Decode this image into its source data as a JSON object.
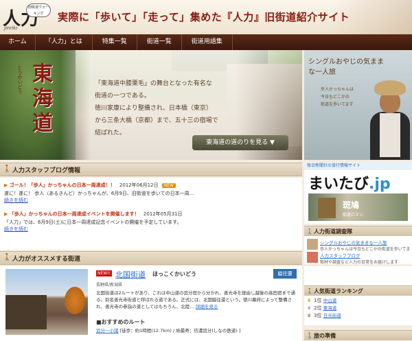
{
  "header": {
    "logo_text": "人力",
    "logo_sub": "jinriki",
    "logo_bubble": "旧街道ウォーキング",
    "title": "実際に「歩いて」「走って」集めた『人力』旧街道紹介サイト"
  },
  "nav": [
    "ホーム",
    "「人力」とは",
    "特集一覧",
    "街道一覧",
    "街道用語集"
  ],
  "hero": {
    "ruby": "とうかいどう",
    "title": "東海道",
    "text_lines": [
      "「東海道中膝栗毛」の舞台となった有名な",
      "街道の一つである。",
      "徳川家康により整備され、日本橋（東京）",
      "から三条大橋（京都）まで、五十三の宿場で",
      "結ばれた。"
    ],
    "button": "東海道の道のりを見る ▼"
  },
  "side_banner": {
    "title": "シングルおやじの気ままな一人旅",
    "sub_lines": [
      "歩人かっちゃんは",
      "今日もどこかの",
      "街道を歩いてます"
    ]
  },
  "blog": {
    "title": "人力スタッフブログ情報",
    "items": [
      {
        "link": "ゴール！「歩人」かっちゃんの日本一周達成！！",
        "date": "2012年06月12日",
        "badge": "NEW",
        "body": "遂に！遂に！ 歩人（あるきんど）かっちゃんが、6月9日、旧街道を歩いての日本一周…",
        "more": "続きを読む"
      },
      {
        "link": "「歩人」かっちゃんの日本一周達成イベントを開催します！",
        "date": "2012年05月31日",
        "badge": "",
        "body": "「人力」では、6月9日(土)に日本一周達成記念イベントの開催を予定しています。",
        "more": "続きを読む"
      }
    ]
  },
  "recommend": {
    "title": "人力がオススメする街道",
    "badge_new": "NEW!!",
    "name": "北国街道",
    "kana": "ほっこくかいどう",
    "category": "脇往還",
    "location": "長野県/新潟県",
    "desc": "北国街道は2ルートがあり、これは中山道の追分宿から分かれ、善光寺を経由し越後の高田宿まで通る。別名善光寺街道と呼ばれる道である。正式には、北国脇往還という。徳川幕府によって整備され、善光寺の参詣の道としてはもちろん、北陸…",
    "detail": "詳細を見る",
    "route_head": "■おすすめのルート",
    "route_link": "追分〜小諸",
    "route_text": "[徒歩：約1時間(12.7km) / 始最寄：信濃追分(しなの鉄道) ]"
  },
  "maitabi": {
    "tag": "毎日新聞社の旅行情報サイト",
    "logo": "まいたび",
    "logo_jp": ".jp",
    "label": "斑鳩",
    "label2": "街道ロマン"
  },
  "survey": {
    "title": "人力街道調査隊",
    "items": [
      {
        "link": "シングルおやじの気ままな一人旅",
        "sub": "歩人かっちゃんは今日もどこかの街道を歩いてます"
      },
      {
        "link": "人力スタッフブログ",
        "sub": "取材や調査など人力の日常をお届けします"
      }
    ]
  },
  "ranking": {
    "title": "人気街道ランキング",
    "items": [
      {
        "rank": "1位",
        "name": "中山道"
      },
      {
        "rank": "2位",
        "name": "東海道"
      },
      {
        "rank": "3位",
        "name": "日光街道"
      }
    ]
  },
  "prep": {
    "title": "旅の準備"
  }
}
